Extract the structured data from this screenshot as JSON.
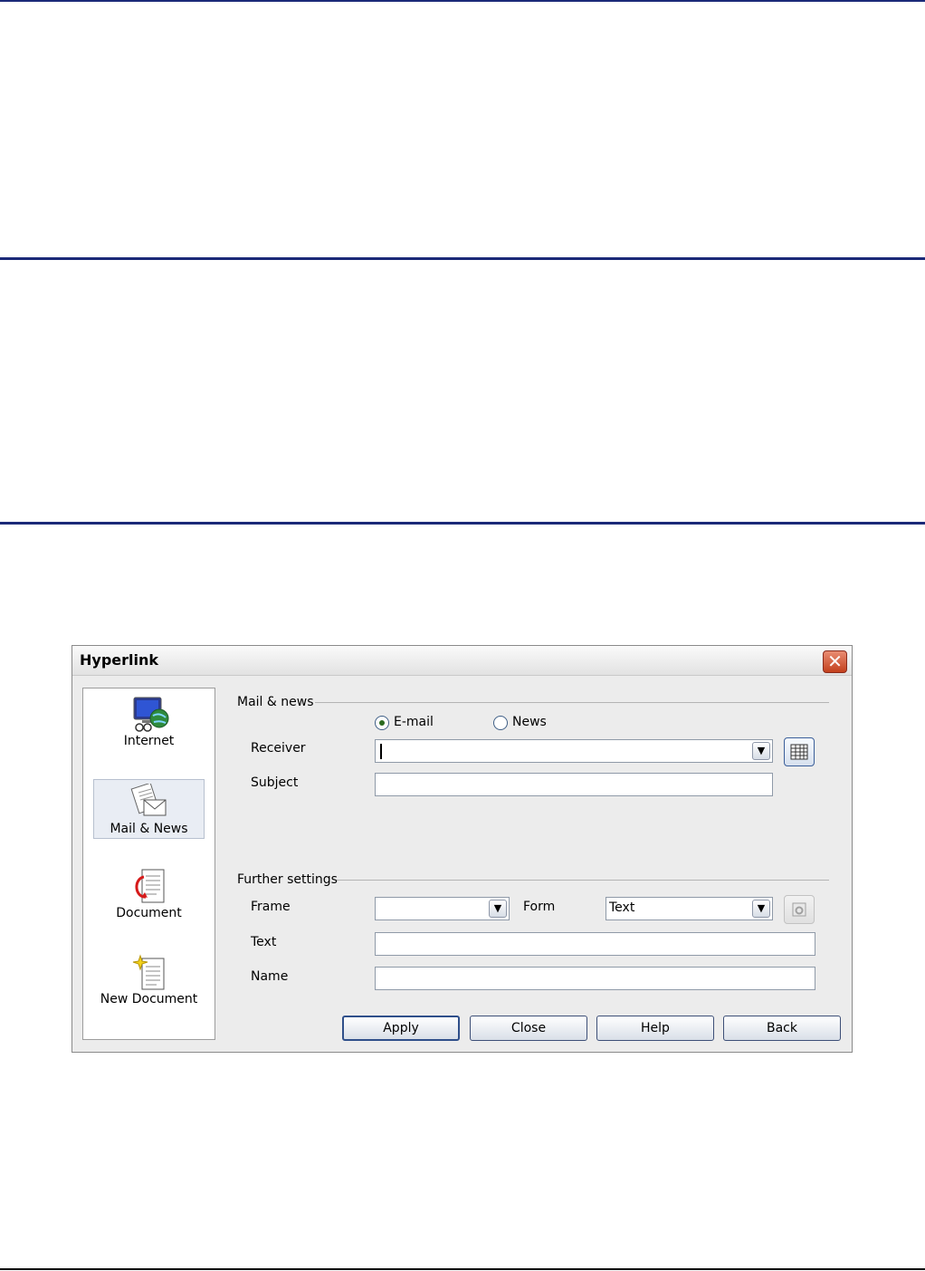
{
  "dialog": {
    "title": "Hyperlink",
    "close_symbol": "✕"
  },
  "sidebar": {
    "items": [
      {
        "label": "Internet",
        "icon": "globe-monitor-icon",
        "selected": false
      },
      {
        "label": "Mail & News",
        "icon": "mail-envelope-icon",
        "selected": true
      },
      {
        "label": "Document",
        "icon": "document-icon",
        "selected": false
      },
      {
        "label": "New Document",
        "icon": "new-document-icon",
        "selected": false
      }
    ]
  },
  "mail_news": {
    "group_label": "Mail & news",
    "radio_email_label": "E-mail",
    "radio_news_label": "News",
    "email_selected": true,
    "receiver_label": "Receiver",
    "receiver_value": "",
    "subject_label": "Subject",
    "subject_value": ""
  },
  "further": {
    "group_label": "Further settings",
    "frame_label": "Frame",
    "frame_value": "",
    "form_label": "Form",
    "form_value": "Text",
    "text_label": "Text",
    "text_value": "",
    "name_label": "Name",
    "name_value": ""
  },
  "buttons": {
    "apply": "Apply",
    "close": "Close",
    "help": "Help",
    "back": "Back"
  },
  "colors": {
    "rule": "#1b2a78",
    "close_button": "#c3401d"
  }
}
